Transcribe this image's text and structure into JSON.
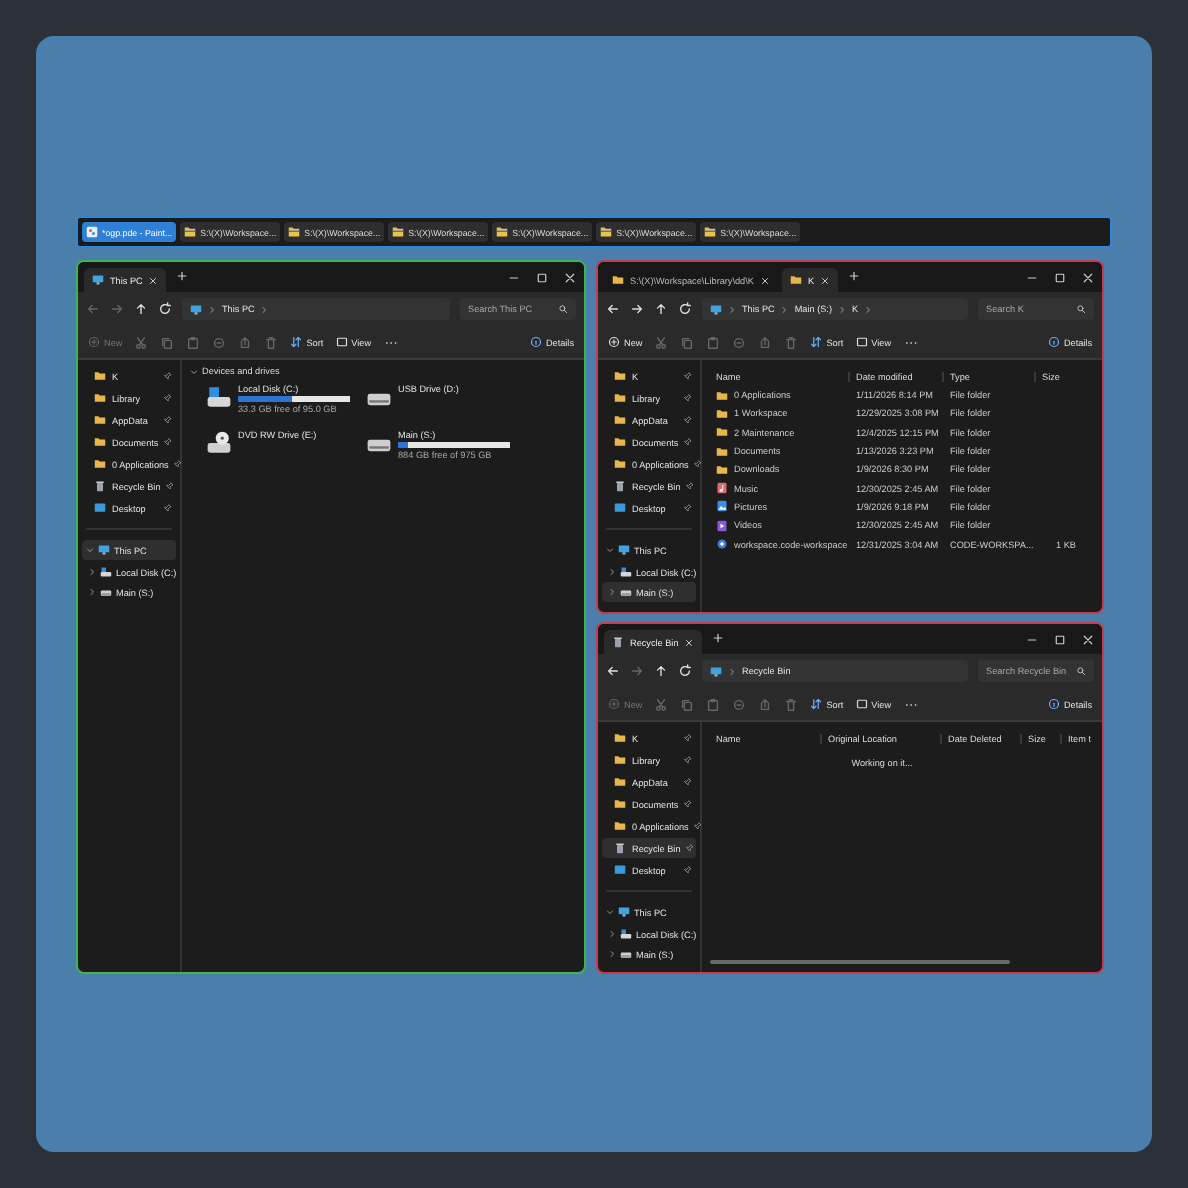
{
  "taskbar": {
    "items": [
      {
        "label": "*ogp.pde - Paint...",
        "kind": "paint",
        "selected": true
      },
      {
        "label": "S:\\(X)\\Workspace...",
        "kind": "explorer",
        "selected": false
      },
      {
        "label": "S:\\(X)\\Workspace...",
        "kind": "explorer",
        "selected": false
      },
      {
        "label": "S:\\(X)\\Workspace...",
        "kind": "explorer",
        "selected": false
      },
      {
        "label": "S:\\(X)\\Workspace...",
        "kind": "explorer",
        "selected": false
      },
      {
        "label": "S:\\(X)\\Workspace...",
        "kind": "explorer",
        "selected": false
      },
      {
        "label": "S:\\(X)\\Workspace...",
        "kind": "explorer",
        "selected": false
      }
    ]
  },
  "windows": [
    {
      "color": "#3db54c",
      "tabs": [
        {
          "title": "This PC",
          "kind": "pc",
          "selected": true
        }
      ],
      "nav": [
        {
          "kind": "back",
          "disabled": true
        },
        {
          "kind": "forward",
          "disabled": true
        },
        {
          "kind": "up",
          "disabled": false
        },
        {
          "kind": "refresh",
          "disabled": false
        }
      ],
      "path": [
        {
          "label": "This PC"
        }
      ],
      "trailing_chevron": true,
      "search": {
        "placeholder": "Search This PC"
      },
      "toolbar": {
        "new": {
          "label": "New",
          "disabled": true
        },
        "sort": "Sort",
        "view": "View",
        "details": "Details"
      },
      "quick_access": [
        {
          "label": "K",
          "kind": "folder",
          "selected": false
        },
        {
          "label": "Library",
          "kind": "folder",
          "selected": false
        },
        {
          "label": "AppData",
          "kind": "folder",
          "selected": false
        },
        {
          "label": "Documents",
          "kind": "folder",
          "selected": false
        },
        {
          "label": "0 Applications",
          "kind": "folder",
          "selected": false
        },
        {
          "label": "Recycle Bin",
          "kind": "bin",
          "selected": false
        },
        {
          "label": "Desktop",
          "kind": "desktop",
          "selected": false
        }
      ],
      "tree": [
        {
          "label": "This PC",
          "kind": "pc",
          "expanded": true,
          "selected": true,
          "children": [
            {
              "label": "Local Disk (C:)",
              "kind": "disk",
              "expanded": false,
              "selected": false
            },
            {
              "label": "Main (S:)",
              "kind": "drive",
              "expanded": false,
              "selected": false
            }
          ]
        }
      ],
      "content": {
        "kind": "drives",
        "section": "Devices and drives",
        "drives": [
          {
            "name": "Local Disk (C:)",
            "kind": "disk",
            "level": 0.48,
            "free": "33.3 GB free of 95.0 GB"
          },
          {
            "name": "USB Drive (D:)",
            "kind": "usb"
          },
          {
            "name": "DVD RW Drive (E:)",
            "kind": "dvd"
          },
          {
            "name": "Main (S:)",
            "kind": "drive",
            "level": 0.09,
            "free": "884 GB free of 975 GB"
          }
        ]
      }
    },
    {
      "color": "#c73a52",
      "tabs": [
        {
          "title": "S:\\(X)\\Workspace\\Library\\dd\\K",
          "kind": "folder",
          "selected": false
        },
        {
          "title": "K",
          "kind": "folder",
          "selected": true
        }
      ],
      "nav": [
        {
          "kind": "back",
          "disabled": false
        },
        {
          "kind": "forward",
          "disabled": false
        },
        {
          "kind": "up",
          "disabled": false
        },
        {
          "kind": "refresh",
          "disabled": false
        }
      ],
      "path": [
        {
          "label": "This PC"
        },
        {
          "label": "Main (S:)"
        },
        {
          "label": "K"
        }
      ],
      "trailing_chevron": true,
      "search": {
        "placeholder": "Search K"
      },
      "toolbar": {
        "new": {
          "label": "New",
          "disabled": false
        },
        "sort": "Sort",
        "view": "View",
        "details": "Details"
      },
      "quick_access": [
        {
          "label": "K",
          "kind": "folder",
          "selected": false
        },
        {
          "label": "Library",
          "kind": "folder",
          "selected": false
        },
        {
          "label": "AppData",
          "kind": "folder",
          "selected": false
        },
        {
          "label": "Documents",
          "kind": "folder",
          "selected": false
        },
        {
          "label": "0 Applications",
          "kind": "folder",
          "selected": false
        },
        {
          "label": "Recycle Bin",
          "kind": "bin",
          "selected": false
        },
        {
          "label": "Desktop",
          "kind": "desktop",
          "selected": false
        }
      ],
      "tree": [
        {
          "label": "This PC",
          "kind": "pc",
          "expanded": true,
          "selected": false,
          "children": [
            {
              "label": "Local Disk (C:)",
              "kind": "disk",
              "expanded": false,
              "selected": false
            },
            {
              "label": "Main (S:)",
              "kind": "drive",
              "expanded": false,
              "selected": true
            }
          ]
        }
      ],
      "content": {
        "kind": "files",
        "columns": [
          {
            "label": "Name"
          },
          {
            "label": "Date modified"
          },
          {
            "label": "Type"
          },
          {
            "label": "Size"
          }
        ],
        "rows": [
          {
            "name": "0 Applications",
            "kind": "folder",
            "date": "1/11/2026 8:14 PM",
            "type": "File folder"
          },
          {
            "name": "1 Workspace",
            "kind": "folder",
            "date": "12/29/2025 3:08 PM",
            "type": "File folder"
          },
          {
            "name": "2 Maintenance",
            "kind": "folder",
            "date": "12/4/2025 12:15 PM",
            "type": "File folder"
          },
          {
            "name": "Documents",
            "kind": "folder",
            "date": "1/13/2026 3:23 PM",
            "type": "File folder"
          },
          {
            "name": "Downloads",
            "kind": "folder",
            "date": "1/9/2026 8:30 PM",
            "type": "File folder"
          },
          {
            "name": "Music",
            "kind": "music",
            "date": "12/30/2025 2:45 AM",
            "type": "File folder"
          },
          {
            "name": "Pictures",
            "kind": "pictures",
            "date": "1/9/2026 9:18 PM",
            "type": "File folder"
          },
          {
            "name": "Videos",
            "kind": "videos",
            "date": "12/30/2025 2:45 AM",
            "type": "File folder"
          },
          {
            "name": "workspace.code-workspace",
            "kind": "file",
            "date": "12/31/2025 3:04 AM",
            "type": "CODE-WORKSPA...",
            "size": "1 KB"
          }
        ]
      }
    },
    {
      "color": "#c73a52",
      "tabs": [
        {
          "title": "Recycle Bin",
          "kind": "bin",
          "selected": true
        }
      ],
      "nav": [
        {
          "kind": "back",
          "disabled": false
        },
        {
          "kind": "forward",
          "disabled": true
        },
        {
          "kind": "up",
          "disabled": false
        },
        {
          "kind": "refresh",
          "disabled": false
        }
      ],
      "path": [
        {
          "label": "Recycle Bin"
        }
      ],
      "trailing_chevron": false,
      "search": {
        "placeholder": "Search Recycle Bin"
      },
      "toolbar": {
        "new": {
          "label": "New",
          "disabled": true
        },
        "sort": "Sort",
        "view": "View",
        "details": "Details"
      },
      "quick_access": [
        {
          "label": "K",
          "kind": "folder",
          "selected": false
        },
        {
          "label": "Library",
          "kind": "folder",
          "selected": false
        },
        {
          "label": "AppData",
          "kind": "folder",
          "selected": false
        },
        {
          "label": "Documents",
          "kind": "folder",
          "selected": false
        },
        {
          "label": "0 Applications",
          "kind": "folder",
          "selected": false
        },
        {
          "label": "Recycle Bin",
          "kind": "bin",
          "selected": true
        },
        {
          "label": "Desktop",
          "kind": "desktop",
          "selected": false
        }
      ],
      "tree": [
        {
          "label": "This PC",
          "kind": "pc",
          "expanded": true,
          "selected": false,
          "children": [
            {
              "label": "Local Disk (C:)",
              "kind": "disk",
              "expanded": false,
              "selected": false
            },
            {
              "label": "Main (S:)",
              "kind": "drive",
              "expanded": false,
              "selected": false
            }
          ]
        }
      ],
      "content": {
        "kind": "empty",
        "columns": [
          {
            "label": "Name"
          },
          {
            "label": "Original Location"
          },
          {
            "label": "Date Deleted"
          },
          {
            "label": "Size"
          },
          {
            "label": "Item t"
          }
        ],
        "message": "Working on it..."
      }
    }
  ]
}
